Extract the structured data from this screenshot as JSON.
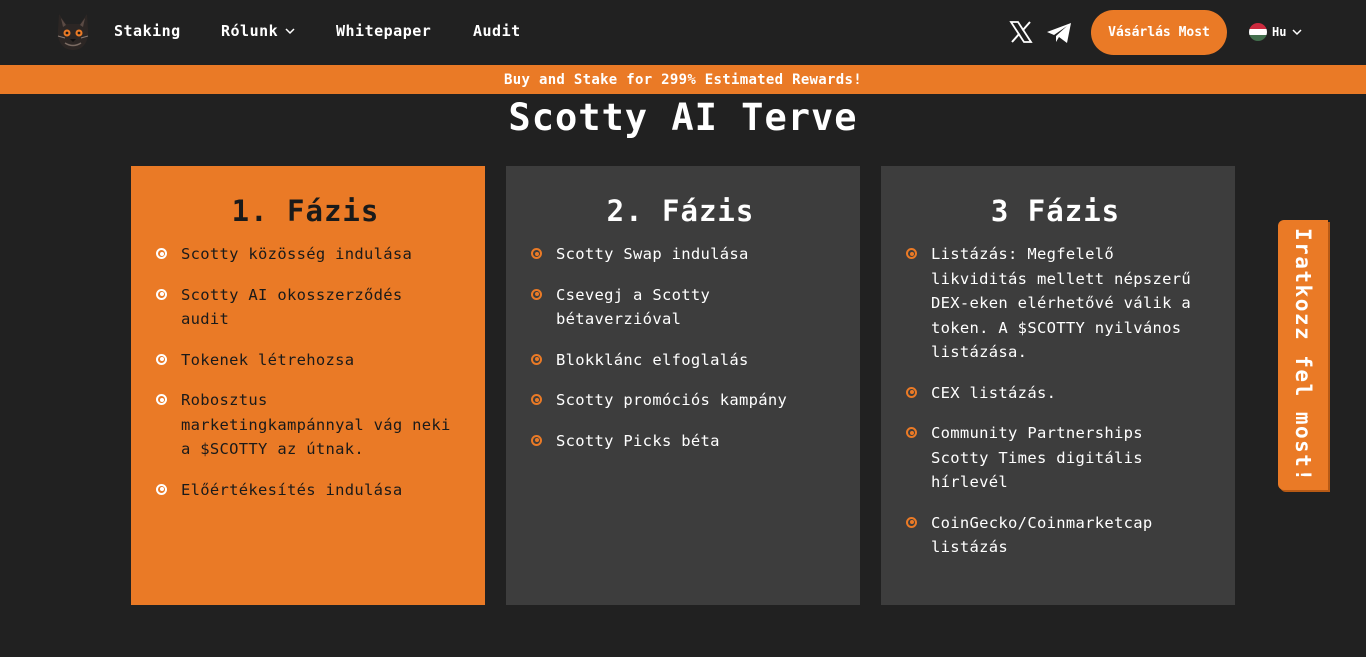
{
  "nav": {
    "links": [
      {
        "label": "Staking"
      },
      {
        "label": "Rólunk"
      },
      {
        "label": "Whitepaper"
      },
      {
        "label": "Audit"
      }
    ],
    "buy_label": "Vásárlás Most",
    "language": "Hu",
    "icons": [
      "logo",
      "chevron-down-icon",
      "x-icon",
      "telegram-icon",
      "hungary-flag-icon"
    ]
  },
  "promo": "Buy and Stake for 299% Estimated Rewards!",
  "title": "Scotty AI Terve",
  "phases": [
    {
      "title": "1. Fázis",
      "items": [
        "Scotty közösség indulása",
        "Scotty AI okosszerződés audit",
        "Tokenek létrehozsa",
        "Robosztus marketingkampánnyal vág neki a $SCOTTY az útnak.",
        "Előértékesítés indulása"
      ]
    },
    {
      "title": "2. Fázis",
      "items": [
        "Scotty Swap indulása",
        "Csevegj a Scotty bétaverzióval",
        "Blokklánc elfoglalás",
        "Scotty promóciós kampány",
        "Scotty Picks béta"
      ]
    },
    {
      "title": "3 Fázis",
      "items": [
        "Listázás: Megfelelő likviditás mellett népszerű DEX-eken elérhetővé válik a token. A $SCOTTY nyilvános listázása.",
        "CEX listázás.",
        "Community Partnerships Scotty Times digitális hírlevél",
        "CoinGecko/Coinmarketcap listázás"
      ]
    }
  ],
  "side_tab": "Iratkozz fel most!",
  "colors": {
    "background": "#212121",
    "accent": "#ea7a26",
    "card_gray": "#3d3d3d"
  }
}
